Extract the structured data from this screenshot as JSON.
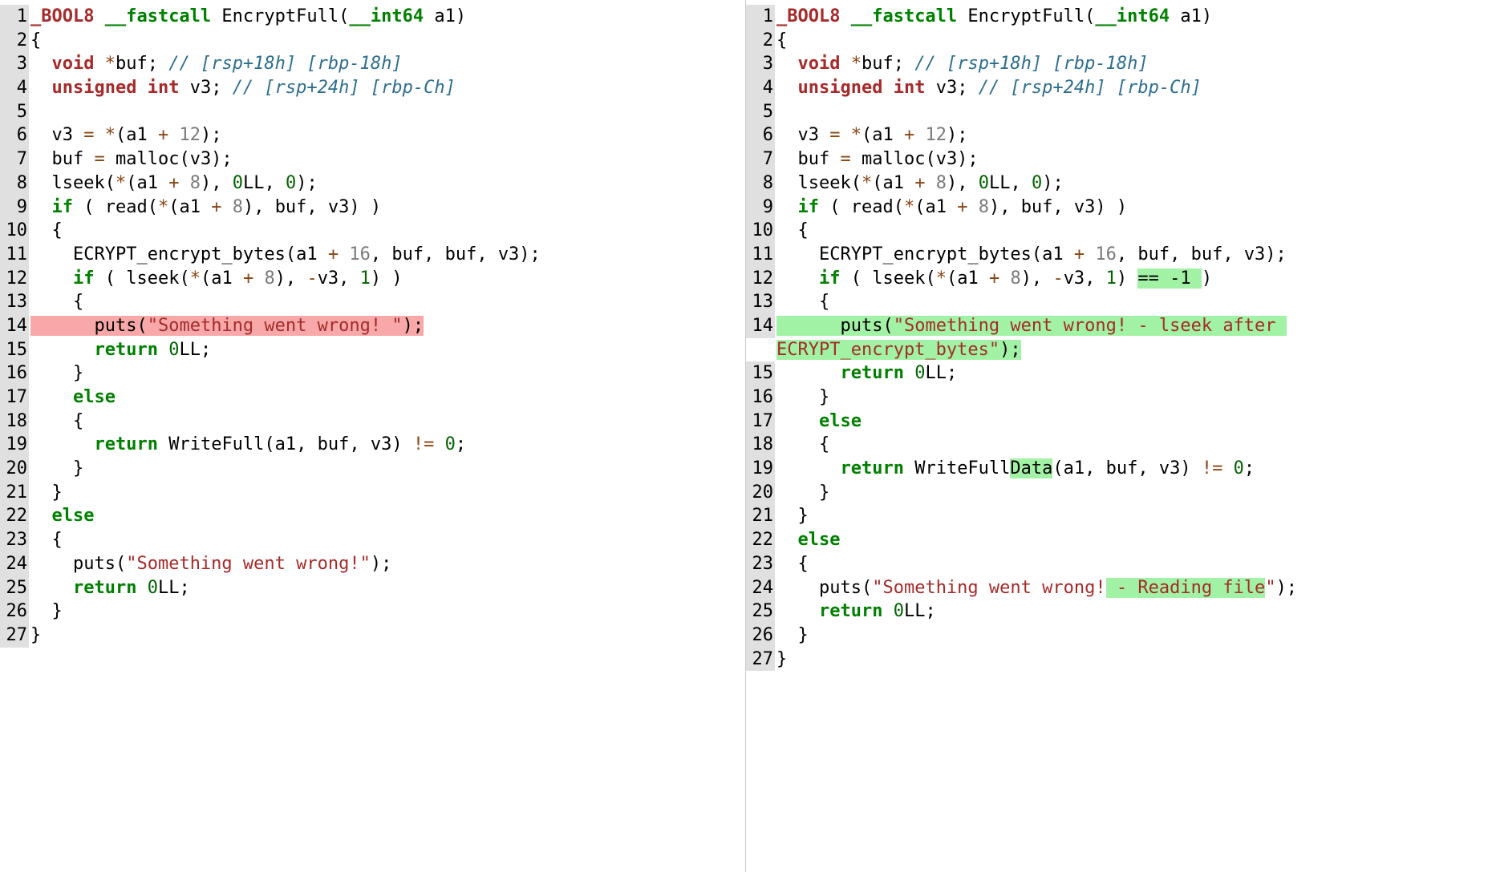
{
  "left": {
    "lines": [
      {
        "no": "1",
        "segs": [
          {
            "c": "t",
            "t": "_BOOL8 "
          },
          {
            "c": "kw",
            "t": "__fastcall "
          },
          {
            "c": "fn",
            "t": "EncryptFull("
          },
          {
            "c": "kw",
            "t": "__int64"
          },
          {
            "c": "fn",
            "t": " a1)"
          }
        ]
      },
      {
        "no": "2",
        "segs": [
          {
            "c": "fn",
            "t": "{"
          }
        ]
      },
      {
        "no": "3",
        "segs": [
          {
            "c": "fn",
            "t": "  "
          },
          {
            "c": "t",
            "t": "void"
          },
          {
            "c": "fn",
            "t": " "
          },
          {
            "c": "op",
            "t": "*"
          },
          {
            "c": "fn",
            "t": "buf; "
          },
          {
            "c": "cm",
            "t": "// [rsp+18h] [rbp-18h]"
          }
        ]
      },
      {
        "no": "4",
        "segs": [
          {
            "c": "fn",
            "t": "  "
          },
          {
            "c": "t",
            "t": "unsigned int"
          },
          {
            "c": "fn",
            "t": " v3; "
          },
          {
            "c": "cm",
            "t": "// [rsp+24h] [rbp-Ch]"
          }
        ]
      },
      {
        "no": "5",
        "segs": [
          {
            "c": "fn",
            "t": ""
          }
        ]
      },
      {
        "no": "6",
        "segs": [
          {
            "c": "fn",
            "t": "  v3 "
          },
          {
            "c": "op",
            "t": "="
          },
          {
            "c": "fn",
            "t": " "
          },
          {
            "c": "op",
            "t": "*"
          },
          {
            "c": "fn",
            "t": "(a1 "
          },
          {
            "c": "op",
            "t": "+"
          },
          {
            "c": "fn",
            "t": " "
          },
          {
            "c": "nml",
            "t": "12"
          },
          {
            "c": "fn",
            "t": ");"
          }
        ]
      },
      {
        "no": "7",
        "segs": [
          {
            "c": "fn",
            "t": "  buf "
          },
          {
            "c": "op",
            "t": "="
          },
          {
            "c": "fn",
            "t": " malloc(v3);"
          }
        ]
      },
      {
        "no": "8",
        "segs": [
          {
            "c": "fn",
            "t": "  lseek("
          },
          {
            "c": "op",
            "t": "*"
          },
          {
            "c": "fn",
            "t": "(a1 "
          },
          {
            "c": "op",
            "t": "+"
          },
          {
            "c": "fn",
            "t": " "
          },
          {
            "c": "nml",
            "t": "8"
          },
          {
            "c": "fn",
            "t": "), "
          },
          {
            "c": "nm",
            "t": "0"
          },
          {
            "c": "fn",
            "t": "LL, "
          },
          {
            "c": "nm",
            "t": "0"
          },
          {
            "c": "fn",
            "t": ");"
          }
        ]
      },
      {
        "no": "9",
        "segs": [
          {
            "c": "fn",
            "t": "  "
          },
          {
            "c": "kw",
            "t": "if"
          },
          {
            "c": "fn",
            "t": " ( read("
          },
          {
            "c": "op",
            "t": "*"
          },
          {
            "c": "fn",
            "t": "(a1 "
          },
          {
            "c": "op",
            "t": "+"
          },
          {
            "c": "fn",
            "t": " "
          },
          {
            "c": "nml",
            "t": "8"
          },
          {
            "c": "fn",
            "t": "), buf, v3) )"
          }
        ]
      },
      {
        "no": "10",
        "segs": [
          {
            "c": "fn",
            "t": "  {"
          }
        ]
      },
      {
        "no": "11",
        "segs": [
          {
            "c": "fn",
            "t": "    ECRYPT_encrypt_bytes(a1 "
          },
          {
            "c": "op",
            "t": "+"
          },
          {
            "c": "fn",
            "t": " "
          },
          {
            "c": "nml",
            "t": "16"
          },
          {
            "c": "fn",
            "t": ", buf, buf, v3);"
          }
        ]
      },
      {
        "no": "12",
        "segs": [
          {
            "c": "fn",
            "t": "    "
          },
          {
            "c": "kw",
            "t": "if"
          },
          {
            "c": "fn",
            "t": " ( lseek("
          },
          {
            "c": "op",
            "t": "*"
          },
          {
            "c": "fn",
            "t": "(a1 "
          },
          {
            "c": "op",
            "t": "+"
          },
          {
            "c": "fn",
            "t": " "
          },
          {
            "c": "nml",
            "t": "8"
          },
          {
            "c": "fn",
            "t": "), "
          },
          {
            "c": "op",
            "t": "-"
          },
          {
            "c": "fn",
            "t": "v3, "
          },
          {
            "c": "nm",
            "t": "1"
          },
          {
            "c": "fn",
            "t": ") )"
          }
        ]
      },
      {
        "no": "13",
        "segs": [
          {
            "c": "fn",
            "t": "    {"
          }
        ]
      },
      {
        "no": "14",
        "segs": [
          {
            "c": "fn",
            "hl": "del",
            "t": "      puts("
          },
          {
            "c": "str",
            "hl": "del",
            "t": "\"Something went wrong! \""
          },
          {
            "c": "fn",
            "hl": "del",
            "t": ");"
          }
        ]
      },
      {
        "no": "15",
        "segs": [
          {
            "c": "fn",
            "t": "      "
          },
          {
            "c": "kw",
            "t": "return"
          },
          {
            "c": "fn",
            "t": " "
          },
          {
            "c": "nm",
            "t": "0"
          },
          {
            "c": "fn",
            "t": "LL;"
          }
        ]
      },
      {
        "no": "16",
        "segs": [
          {
            "c": "fn",
            "t": "    }"
          }
        ]
      },
      {
        "no": "17",
        "segs": [
          {
            "c": "fn",
            "t": "    "
          },
          {
            "c": "kw",
            "t": "else"
          }
        ]
      },
      {
        "no": "18",
        "segs": [
          {
            "c": "fn",
            "t": "    {"
          }
        ]
      },
      {
        "no": "19",
        "segs": [
          {
            "c": "fn",
            "t": "      "
          },
          {
            "c": "kw",
            "t": "return"
          },
          {
            "c": "fn",
            "t": " WriteFull(a1, buf, v3) "
          },
          {
            "c": "op",
            "t": "!="
          },
          {
            "c": "fn",
            "t": " "
          },
          {
            "c": "nm",
            "t": "0"
          },
          {
            "c": "fn",
            "t": ";"
          }
        ]
      },
      {
        "no": "20",
        "segs": [
          {
            "c": "fn",
            "t": "    }"
          }
        ]
      },
      {
        "no": "21",
        "segs": [
          {
            "c": "fn",
            "t": "  }"
          }
        ]
      },
      {
        "no": "22",
        "segs": [
          {
            "c": "fn",
            "t": "  "
          },
          {
            "c": "kw",
            "t": "else"
          }
        ]
      },
      {
        "no": "23",
        "segs": [
          {
            "c": "fn",
            "t": "  {"
          }
        ]
      },
      {
        "no": "24",
        "segs": [
          {
            "c": "fn",
            "t": "    puts("
          },
          {
            "c": "str",
            "t": "\"Something went wrong!\""
          },
          {
            "c": "fn",
            "t": ");"
          }
        ]
      },
      {
        "no": "25",
        "segs": [
          {
            "c": "fn",
            "t": "    "
          },
          {
            "c": "kw",
            "t": "return"
          },
          {
            "c": "fn",
            "t": " "
          },
          {
            "c": "nm",
            "t": "0"
          },
          {
            "c": "fn",
            "t": "LL;"
          }
        ]
      },
      {
        "no": "26",
        "segs": [
          {
            "c": "fn",
            "t": "  }"
          }
        ]
      },
      {
        "no": "27",
        "segs": [
          {
            "c": "fn",
            "t": "}"
          }
        ]
      }
    ]
  },
  "right": {
    "lines": [
      {
        "no": "1",
        "segs": [
          {
            "c": "t",
            "t": "_BOOL8 "
          },
          {
            "c": "kw",
            "t": "__fastcall "
          },
          {
            "c": "fn",
            "t": "EncryptFull("
          },
          {
            "c": "kw",
            "t": "__int64"
          },
          {
            "c": "fn",
            "t": " a1)"
          }
        ]
      },
      {
        "no": "2",
        "segs": [
          {
            "c": "fn",
            "t": "{"
          }
        ]
      },
      {
        "no": "3",
        "segs": [
          {
            "c": "fn",
            "t": "  "
          },
          {
            "c": "t",
            "t": "void"
          },
          {
            "c": "fn",
            "t": " "
          },
          {
            "c": "op",
            "t": "*"
          },
          {
            "c": "fn",
            "t": "buf; "
          },
          {
            "c": "cm",
            "t": "// [rsp+18h] [rbp-18h]"
          }
        ]
      },
      {
        "no": "4",
        "segs": [
          {
            "c": "fn",
            "t": "  "
          },
          {
            "c": "t",
            "t": "unsigned int"
          },
          {
            "c": "fn",
            "t": " v3; "
          },
          {
            "c": "cm",
            "t": "// [rsp+24h] [rbp-Ch]"
          }
        ]
      },
      {
        "no": "5",
        "segs": [
          {
            "c": "fn",
            "t": ""
          }
        ]
      },
      {
        "no": "6",
        "segs": [
          {
            "c": "fn",
            "t": "  v3 "
          },
          {
            "c": "op",
            "t": "="
          },
          {
            "c": "fn",
            "t": " "
          },
          {
            "c": "op",
            "t": "*"
          },
          {
            "c": "fn",
            "t": "(a1 "
          },
          {
            "c": "op",
            "t": "+"
          },
          {
            "c": "fn",
            "t": " "
          },
          {
            "c": "nml",
            "t": "12"
          },
          {
            "c": "fn",
            "t": ");"
          }
        ]
      },
      {
        "no": "7",
        "segs": [
          {
            "c": "fn",
            "t": "  buf "
          },
          {
            "c": "op",
            "t": "="
          },
          {
            "c": "fn",
            "t": " malloc(v3);"
          }
        ]
      },
      {
        "no": "8",
        "segs": [
          {
            "c": "fn",
            "t": "  lseek("
          },
          {
            "c": "op",
            "t": "*"
          },
          {
            "c": "fn",
            "t": "(a1 "
          },
          {
            "c": "op",
            "t": "+"
          },
          {
            "c": "fn",
            "t": " "
          },
          {
            "c": "nml",
            "t": "8"
          },
          {
            "c": "fn",
            "t": "), "
          },
          {
            "c": "nm",
            "t": "0"
          },
          {
            "c": "fn",
            "t": "LL, "
          },
          {
            "c": "nm",
            "t": "0"
          },
          {
            "c": "fn",
            "t": ");"
          }
        ]
      },
      {
        "no": "9",
        "segs": [
          {
            "c": "fn",
            "t": "  "
          },
          {
            "c": "kw",
            "t": "if"
          },
          {
            "c": "fn",
            "t": " ( read("
          },
          {
            "c": "op",
            "t": "*"
          },
          {
            "c": "fn",
            "t": "(a1 "
          },
          {
            "c": "op",
            "t": "+"
          },
          {
            "c": "fn",
            "t": " "
          },
          {
            "c": "nml",
            "t": "8"
          },
          {
            "c": "fn",
            "t": "), buf, v3) )"
          }
        ]
      },
      {
        "no": "10",
        "segs": [
          {
            "c": "fn",
            "t": "  {"
          }
        ]
      },
      {
        "no": "11",
        "segs": [
          {
            "c": "fn",
            "t": "    ECRYPT_encrypt_bytes(a1 "
          },
          {
            "c": "op",
            "t": "+"
          },
          {
            "c": "fn",
            "t": " "
          },
          {
            "c": "nml",
            "t": "16"
          },
          {
            "c": "fn",
            "t": ", buf, buf, v3);"
          }
        ]
      },
      {
        "no": "12",
        "segs": [
          {
            "c": "fn",
            "t": "    "
          },
          {
            "c": "kw",
            "t": "if"
          },
          {
            "c": "fn",
            "t": " ( lseek("
          },
          {
            "c": "op",
            "t": "*"
          },
          {
            "c": "fn",
            "t": "(a1 "
          },
          {
            "c": "op",
            "t": "+"
          },
          {
            "c": "fn",
            "t": " "
          },
          {
            "c": "nml",
            "t": "8"
          },
          {
            "c": "fn",
            "t": "), "
          },
          {
            "c": "op",
            "t": "-"
          },
          {
            "c": "fn",
            "t": "v3, "
          },
          {
            "c": "nm",
            "t": "1"
          },
          {
            "c": "fn",
            "t": ") "
          },
          {
            "c": "fn",
            "hl": "add",
            "t": "== -1 "
          },
          {
            "c": "fn",
            "t": ")"
          }
        ]
      },
      {
        "no": "13",
        "segs": [
          {
            "c": "fn",
            "t": "    {"
          }
        ]
      },
      {
        "no": "14",
        "segs": [
          {
            "c": "fn",
            "hl": "add",
            "t": "      puts("
          },
          {
            "c": "str",
            "hl": "add",
            "t": "\"Something went wrong! - lseek after ECRYPT_encrypt_bytes\""
          },
          {
            "c": "fn",
            "hl": "add",
            "t": ");"
          }
        ]
      },
      {
        "no": "15",
        "segs": [
          {
            "c": "fn",
            "t": "      "
          },
          {
            "c": "kw",
            "t": "return"
          },
          {
            "c": "fn",
            "t": " "
          },
          {
            "c": "nm",
            "t": "0"
          },
          {
            "c": "fn",
            "t": "LL;"
          }
        ]
      },
      {
        "no": "16",
        "segs": [
          {
            "c": "fn",
            "t": "    }"
          }
        ]
      },
      {
        "no": "17",
        "segs": [
          {
            "c": "fn",
            "t": "    "
          },
          {
            "c": "kw",
            "t": "else"
          }
        ]
      },
      {
        "no": "18",
        "segs": [
          {
            "c": "fn",
            "t": "    {"
          }
        ]
      },
      {
        "no": "19",
        "segs": [
          {
            "c": "fn",
            "t": "      "
          },
          {
            "c": "kw",
            "t": "return"
          },
          {
            "c": "fn",
            "t": " WriteFull"
          },
          {
            "c": "fn",
            "hl": "add",
            "t": "Data"
          },
          {
            "c": "fn",
            "t": "(a1, buf, v3) "
          },
          {
            "c": "op",
            "t": "!="
          },
          {
            "c": "fn",
            "t": " "
          },
          {
            "c": "nm",
            "t": "0"
          },
          {
            "c": "fn",
            "t": ";"
          }
        ]
      },
      {
        "no": "20",
        "segs": [
          {
            "c": "fn",
            "t": "    }"
          }
        ]
      },
      {
        "no": "21",
        "segs": [
          {
            "c": "fn",
            "t": "  }"
          }
        ]
      },
      {
        "no": "22",
        "segs": [
          {
            "c": "fn",
            "t": "  "
          },
          {
            "c": "kw",
            "t": "else"
          }
        ]
      },
      {
        "no": "23",
        "segs": [
          {
            "c": "fn",
            "t": "  {"
          }
        ]
      },
      {
        "no": "24",
        "segs": [
          {
            "c": "fn",
            "t": "    puts("
          },
          {
            "c": "str",
            "t": "\"Something went wrong!"
          },
          {
            "c": "str",
            "hl": "add",
            "t": " - Reading file"
          },
          {
            "c": "str",
            "t": "\""
          },
          {
            "c": "fn",
            "t": ");"
          }
        ]
      },
      {
        "no": "25",
        "segs": [
          {
            "c": "fn",
            "t": "    "
          },
          {
            "c": "kw",
            "t": "return"
          },
          {
            "c": "fn",
            "t": " "
          },
          {
            "c": "nm",
            "t": "0"
          },
          {
            "c": "fn",
            "t": "LL;"
          }
        ]
      },
      {
        "no": "26",
        "segs": [
          {
            "c": "fn",
            "t": "  }"
          }
        ]
      },
      {
        "no": "27",
        "segs": [
          {
            "c": "fn",
            "t": "}"
          }
        ]
      }
    ]
  }
}
